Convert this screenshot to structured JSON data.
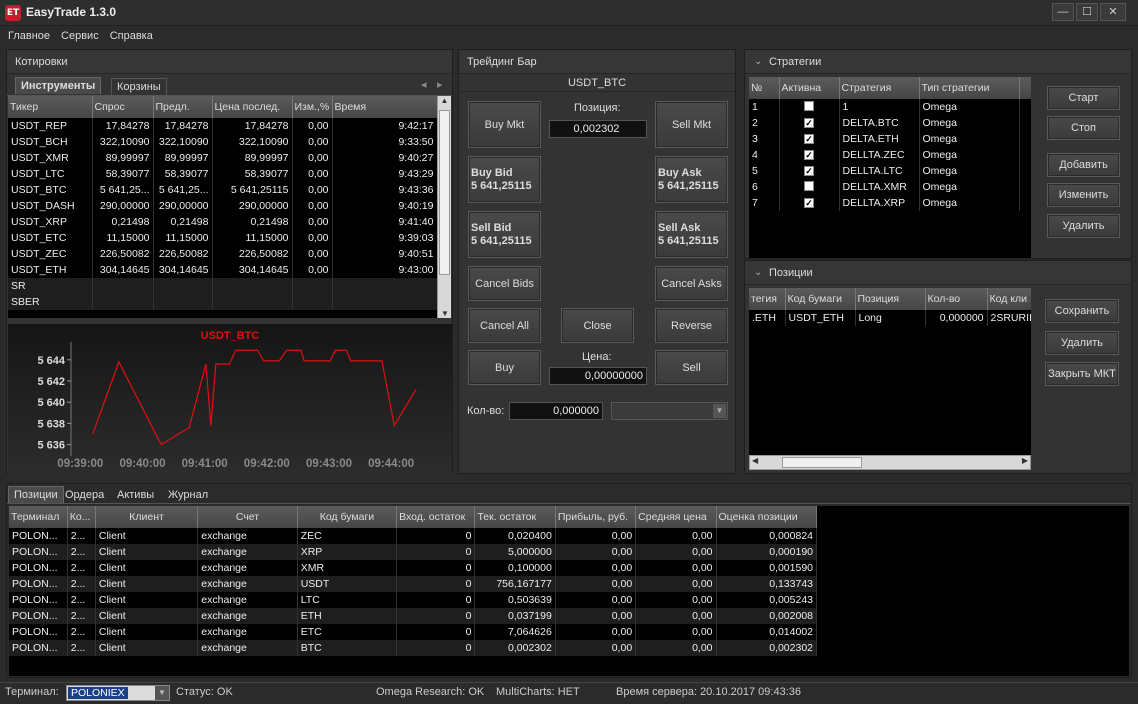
{
  "app": {
    "title": "EasyTrade 1.3.0",
    "icon_text": "ET"
  },
  "window": {
    "minimize": "—",
    "maximize": "☐",
    "close": "✕"
  },
  "menu": [
    "Главное",
    "Сервис",
    "Справка"
  ],
  "quotes": {
    "title": "Котировки",
    "tabs": [
      "Инструменты",
      "Корзины"
    ],
    "columns": [
      "Тикер",
      "Спрос",
      "Предл.",
      "Цена послед.",
      "Изм.,%",
      "Время"
    ],
    "rows": [
      [
        "USDT_REP",
        "17,84278",
        "17,84278",
        "17,84278",
        "0,00",
        "9:42:17"
      ],
      [
        "USDT_BCH",
        "322,10090",
        "322,10090",
        "322,10090",
        "0,00",
        "9:33:50"
      ],
      [
        "USDT_XMR",
        "89,99997",
        "89,99997",
        "89,99997",
        "0,00",
        "9:40:27"
      ],
      [
        "USDT_LTC",
        "58,39077",
        "58,39077",
        "58,39077",
        "0,00",
        "9:43:29"
      ],
      [
        "USDT_BTC",
        "5 641,25...",
        "5 641,25...",
        "5 641,25115",
        "0,00",
        "9:43:36"
      ],
      [
        "USDT_DASH",
        "290,00000",
        "290,00000",
        "290,00000",
        "0,00",
        "9:40:19"
      ],
      [
        "USDT_XRP",
        "0,21498",
        "0,21498",
        "0,21498",
        "0,00",
        "9:41:40"
      ],
      [
        "USDT_ETC",
        "11,15000",
        "11,15000",
        "11,15000",
        "0,00",
        "9:39:03"
      ],
      [
        "USDT_ZEC",
        "226,50082",
        "226,50082",
        "226,50082",
        "0,00",
        "9:40:51"
      ],
      [
        "USDT_ETH",
        "304,14645",
        "304,14645",
        "304,14645",
        "0,00",
        "9:43:00"
      ],
      [
        "SR",
        "",
        "",
        "",
        "",
        ""
      ],
      [
        "SBER",
        "",
        "",
        "",
        "",
        ""
      ]
    ]
  },
  "chart_data": {
    "type": "line",
    "title": "USDT_BTC",
    "ylabel": "",
    "xlabel": "",
    "yticks": [
      "5 644",
      "5 642",
      "5 640",
      "5 638",
      "5 636"
    ],
    "ylim": [
      5635.3,
      5645.3
    ],
    "xticks": [
      "09:39:00",
      "09:40:00",
      "09:41:00",
      "09:42:00",
      "09:43:00",
      "09:44:00"
    ],
    "xlim": [
      0,
      6
    ],
    "color": "#e01010",
    "points": [
      [
        0.2,
        5637.0
      ],
      [
        0.62,
        5643.8
      ],
      [
        1.3,
        5636.0
      ],
      [
        1.75,
        5637.6
      ],
      [
        2.02,
        5643.6
      ],
      [
        2.1,
        5637.8
      ],
      [
        2.18,
        5643.6
      ],
      [
        2.4,
        5643.6
      ],
      [
        2.5,
        5644.9
      ],
      [
        2.85,
        5644.9
      ],
      [
        2.95,
        5643.9
      ],
      [
        3.2,
        5643.9
      ],
      [
        3.32,
        5644.9
      ],
      [
        3.55,
        5644.9
      ],
      [
        3.6,
        5643.9
      ],
      [
        4.02,
        5643.9
      ],
      [
        4.1,
        5644.9
      ],
      [
        4.28,
        5644.9
      ],
      [
        4.35,
        5643.9
      ],
      [
        4.85,
        5643.9
      ],
      [
        5.05,
        5637.8
      ],
      [
        5.4,
        5641.2
      ]
    ]
  },
  "trading": {
    "title": "Трейдинг Бар",
    "symbol": "USDT_BTC",
    "position_label": "Позиция:",
    "position_value": "0,002302",
    "buy_mkt": "Buy Mkt",
    "sell_mkt": "Sell Mkt",
    "buy_bid": "Buy Bid",
    "buy_bid_price": "5 641,25115",
    "buy_ask": "Buy Ask",
    "buy_ask_price": "5 641,25115",
    "sell_bid": "Sell Bid",
    "sell_bid_price": "5 641,25115",
    "sell_ask": "Sell Ask",
    "sell_ask_price": "5 641,25115",
    "cancel_bids": "Cancel Bids",
    "cancel_asks": "Cancel Asks",
    "cancel_all": "Cancel All",
    "close": "Close",
    "reverse": "Reverse",
    "buy": "Buy",
    "sell": "Sell",
    "price_label": "Цена:",
    "price_value": "0,00000000",
    "qty_label": "Кол-во:",
    "qty_value": "0,000000"
  },
  "strategies": {
    "title": "Стратегии",
    "columns": [
      "№",
      "Активна",
      "Стратегия",
      "Тип стратегии"
    ],
    "rows": [
      [
        "1",
        false,
        "1",
        "Omega"
      ],
      [
        "2",
        true,
        "DELTA.BTC",
        "Omega"
      ],
      [
        "3",
        true,
        "DELTA.ETH",
        "Omega"
      ],
      [
        "4",
        true,
        "DELLTA.ZEC",
        "Omega"
      ],
      [
        "5",
        true,
        "DELLTA.LTC",
        "Omega"
      ],
      [
        "6",
        false,
        "DELLTA.XMR",
        "Omega"
      ],
      [
        "7",
        true,
        "DELLTA.XRP",
        "Omega"
      ]
    ],
    "buttons": [
      "Старт",
      "Стоп",
      "Добавить",
      "Изменить",
      "Удалить"
    ]
  },
  "positions_panel": {
    "title": "Позиции",
    "columns": [
      "тегия",
      "Код бумаги",
      "Позиция",
      "Кол-во",
      "Код кли"
    ],
    "rows": [
      [
        ".ETH",
        "USDT_ETH",
        "Long",
        "0,000000",
        "2SRURII"
      ]
    ],
    "buttons": [
      "Сохранить",
      "Удалить",
      "Закрыть МКТ"
    ]
  },
  "bottom": {
    "tabs": [
      "Позиции",
      "Ордера",
      "Активы",
      "Журнал"
    ],
    "columns": [
      "Терминал",
      "Ко...",
      "Клиент",
      "Счет",
      "Код бумаги",
      "Вход. остаток",
      "Тек. остаток",
      "Прибыль, руб.",
      "Средняя цена",
      "Оценка позиции"
    ],
    "rows": [
      [
        "POLON...",
        "2...",
        "Client",
        "exchange",
        "ZEC",
        "0",
        "0,020400",
        "0,00",
        "0,00",
        "0,000824"
      ],
      [
        "POLON...",
        "2...",
        "Client",
        "exchange",
        "XRP",
        "0",
        "5,000000",
        "0,00",
        "0,00",
        "0,000190"
      ],
      [
        "POLON...",
        "2...",
        "Client",
        "exchange",
        "XMR",
        "0",
        "0,100000",
        "0,00",
        "0,00",
        "0,001590"
      ],
      [
        "POLON...",
        "2...",
        "Client",
        "exchange",
        "USDT",
        "0",
        "756,167177",
        "0,00",
        "0,00",
        "0,133743"
      ],
      [
        "POLON...",
        "2...",
        "Client",
        "exchange",
        "LTC",
        "0",
        "0,503639",
        "0,00",
        "0,00",
        "0,005243"
      ],
      [
        "POLON...",
        "2...",
        "Client",
        "exchange",
        "ETH",
        "0",
        "0,037199",
        "0,00",
        "0,00",
        "0,002008"
      ],
      [
        "POLON...",
        "2...",
        "Client",
        "exchange",
        "ETC",
        "0",
        "7,064626",
        "0,00",
        "0,00",
        "0,014002"
      ],
      [
        "POLON...",
        "2...",
        "Client",
        "exchange",
        "BTC",
        "0",
        "0,002302",
        "0,00",
        "0,00",
        "0,002302"
      ]
    ]
  },
  "statusbar": {
    "terminal_label": "Терминал:",
    "terminal_value": "POLONIEX",
    "status": "Статус: OK",
    "omega": "Omega Research: OK",
    "multicharts": "MultiCharts: НЕТ",
    "server_time": "Время сервера: 20.10.2017 09:43:36"
  }
}
